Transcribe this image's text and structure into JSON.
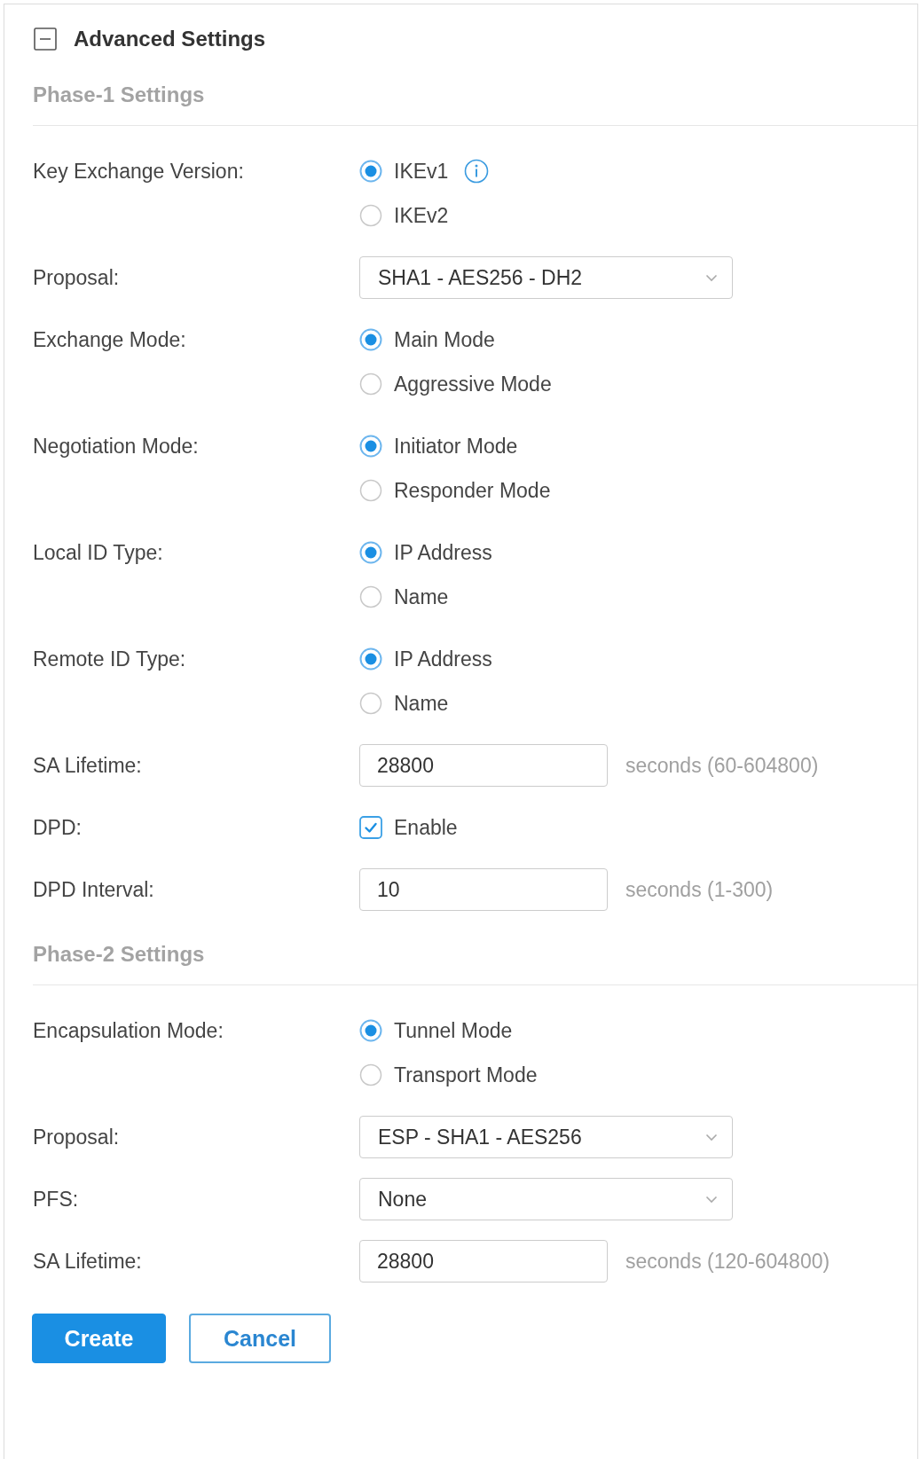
{
  "panel": {
    "title": "Advanced Settings",
    "expanded": true
  },
  "sections": [
    {
      "title": "Phase-1 Settings",
      "fields": [
        {
          "kind": "radio",
          "label": "Key Exchange Version:",
          "options": [
            {
              "label": "IKEv1",
              "selected": true,
              "info": true
            },
            {
              "label": "IKEv2",
              "selected": false
            }
          ]
        },
        {
          "kind": "select",
          "label": "Proposal:",
          "value": "SHA1 - AES256 - DH2"
        },
        {
          "kind": "radio",
          "label": "Exchange Mode:",
          "options": [
            {
              "label": "Main Mode",
              "selected": true
            },
            {
              "label": "Aggressive Mode",
              "selected": false
            }
          ]
        },
        {
          "kind": "radio",
          "label": "Negotiation Mode:",
          "options": [
            {
              "label": "Initiator Mode",
              "selected": true
            },
            {
              "label": "Responder Mode",
              "selected": false
            }
          ]
        },
        {
          "kind": "radio",
          "label": "Local ID Type:",
          "options": [
            {
              "label": "IP Address",
              "selected": true
            },
            {
              "label": "Name",
              "selected": false
            }
          ]
        },
        {
          "kind": "radio",
          "label": "Remote ID Type:",
          "options": [
            {
              "label": "IP Address",
              "selected": true
            },
            {
              "label": "Name",
              "selected": false
            }
          ]
        },
        {
          "kind": "input",
          "label": "SA Lifetime:",
          "value": "28800",
          "note": "seconds (60-604800)"
        },
        {
          "kind": "checkbox",
          "label": "DPD:",
          "option": "Enable",
          "checked": true
        },
        {
          "kind": "input",
          "label": "DPD Interval:",
          "value": "10",
          "note": "seconds (1-300)"
        }
      ]
    },
    {
      "title": "Phase-2 Settings",
      "fields": [
        {
          "kind": "radio",
          "label": "Encapsulation Mode:",
          "options": [
            {
              "label": "Tunnel Mode",
              "selected": true
            },
            {
              "label": "Transport Mode",
              "selected": false
            }
          ]
        },
        {
          "kind": "select",
          "label": "Proposal:",
          "value": "ESP - SHA1 - AES256"
        },
        {
          "kind": "select",
          "label": "PFS:",
          "value": "None"
        },
        {
          "kind": "input",
          "label": "SA Lifetime:",
          "value": "28800",
          "note": "seconds (120-604800)"
        }
      ]
    }
  ],
  "buttons": [
    {
      "label": "Create",
      "kind": "submit"
    },
    {
      "label": "Cancel",
      "kind": "cancel"
    }
  ]
}
